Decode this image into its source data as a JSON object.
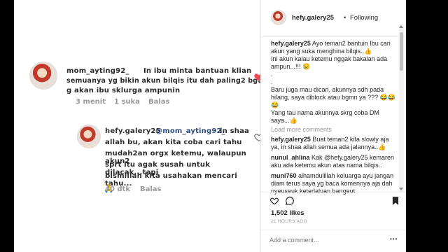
{
  "photo": {
    "comment1": {
      "username": "mom_ayting92_",
      "text_line1": "In ibu minta bantuan klian",
      "text_line2": "semuanya yg bikin akun bilqis itu dah paling2 bgt",
      "text_line3": "g akan ibu sklurga ampunin",
      "time": "3 menit",
      "likes": "1 suka",
      "reply": "Balas"
    },
    "comment2": {
      "username": "hefy.galery25",
      "mention": "@mom_ayting92_",
      "text_line1": "in shaa",
      "text_line2": "allah bu, akan kita coba cari tahu",
      "text_line3": "mudah2an orgx ketemu, walaupun akun2",
      "text_line4": "sprt itu agak susah untuk dilacak...tapi",
      "text_line5": "bismillah kita usahakan mencari tahu...",
      "emoji": "🙏",
      "time": "40 dtk",
      "reply": "Balas"
    }
  },
  "sidebar": {
    "header": {
      "username": "hefy.galery25",
      "separator": "•",
      "follow_label": "Following"
    },
    "caption": {
      "username": "hefy.galery25",
      "lines": [
        "Ayo teman2 bantuin Ibu cari",
        "akun yang suka menghina bilqis..👍",
        "Ini akun kalau ketemu nggak bakalan ada",
        "ampun...!!! 😢",
        ".",
        ".",
        "Baru juga mau dicari, akunnya sdh pada",
        "hilang, saya diblock atau bgmn ya ??? 😂😂",
        "😂",
        "Yang tau nama akunnya skrg coba DM",
        "saya...👍"
      ]
    },
    "load_more": "Load more comments",
    "comments": [
      {
        "username": "hefy.galery25",
        "text": "Buat teman2 kita slowly aja ya, in shaa allah semua ada jalannya..👍"
      },
      {
        "username": "nunul_ahlina",
        "text": "Kak @hefy.galery25 kemaren aku ada ketemu akun atas nama bilqis.."
      },
      {
        "username": "muni760",
        "text": "alhamdulillah keluarga ayu jangan diam terus saya yg baca komennya aja dah nyeuseuk keterlaluan bangeut"
      }
    ],
    "likes": "1,502 likes",
    "timestamp": "21 HOURS AGO",
    "add_comment_placeholder": "Add a comment...",
    "more_dots": "•••"
  }
}
